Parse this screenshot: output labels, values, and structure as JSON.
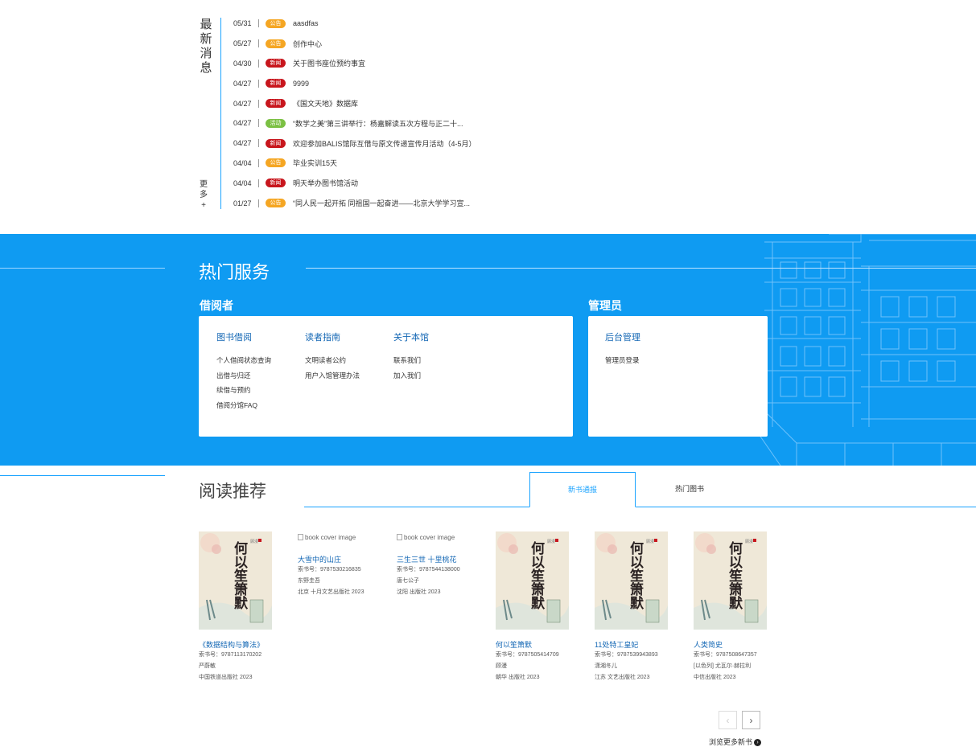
{
  "news": {
    "title": [
      "最",
      "新",
      "消",
      "息"
    ],
    "more": [
      "更",
      "多",
      "+"
    ],
    "items": [
      {
        "date": "05/31",
        "tag": "公告",
        "tag_color": "#f5a623",
        "text": "aasdfas"
      },
      {
        "date": "05/27",
        "tag": "公告",
        "tag_color": "#f5a623",
        "text": "创作中心"
      },
      {
        "date": "04/30",
        "tag": "新闻",
        "tag_color": "#c8161d",
        "text": "关于图书座位预约事宜"
      },
      {
        "date": "04/27",
        "tag": "新闻",
        "tag_color": "#c8161d",
        "text": "9999"
      },
      {
        "date": "04/27",
        "tag": "新闻",
        "tag_color": "#c8161d",
        "text": "《国文天地》数据库"
      },
      {
        "date": "04/27",
        "tag": "活动",
        "tag_color": "#7bc043",
        "text": "“数学之美”第三讲举行：杨嘉解读五次方程与正二十..."
      },
      {
        "date": "04/27",
        "tag": "新闻",
        "tag_color": "#c8161d",
        "text": "欢迎参加BALIS馆际互借与原文传递宣传月活动（4-5月）"
      },
      {
        "date": "04/04",
        "tag": "公告",
        "tag_color": "#f5a623",
        "text": "毕业实训15天"
      },
      {
        "date": "04/04",
        "tag": "新闻",
        "tag_color": "#c8161d",
        "text": "明天举办图书馆活动"
      },
      {
        "date": "01/27",
        "tag": "公告",
        "tag_color": "#f5a623",
        "text": "“同人民一起开拓 同祖国一起奋进——北京大学学习宣..."
      }
    ]
  },
  "services": {
    "title": "热门服务",
    "reader_label": "借阅者",
    "admin_label": "管理员",
    "columns": [
      {
        "head": "图书借阅",
        "links": [
          "个人借阅状态查询",
          "出借与归还",
          "续借与预约",
          "借阅分馆FAQ"
        ]
      },
      {
        "head": "读者指南",
        "links": [
          "文明读者公约",
          "用户入馆管理办法"
        ]
      },
      {
        "head": "关于本馆",
        "links": [
          "联系我们",
          "加入我们"
        ]
      }
    ],
    "admin_column": {
      "head": "后台管理",
      "links": [
        "管理员登录"
      ]
    }
  },
  "recommend": {
    "title": "阅读推荐",
    "tabs": [
      "新书通报",
      "热门图书"
    ],
    "broken_alt": "book cover image",
    "books": [
      {
        "title": "《数据结构与算法》",
        "isbn": "索书号：9787113170202",
        "author": "严蔚敏",
        "publisher": "中国铁道出版社 2023",
        "has_cover": true
      },
      {
        "title": "大雪中的山庄",
        "isbn": "索书号：9787530216835",
        "author": "东野圭吾",
        "publisher": "北京 十月文艺出版社 2023",
        "has_cover": false
      },
      {
        "title": "三生三世 十里桃花",
        "isbn": "索书号：9787544138000",
        "author": "唐七公子",
        "publisher": "沈阳 出版社 2023",
        "has_cover": false
      },
      {
        "title": "何以笙箫默",
        "isbn": "索书号：9787505414709",
        "author": "顾漫",
        "publisher": "朝华 出版社 2023",
        "has_cover": true
      },
      {
        "title": "11处特工皇妃",
        "isbn": "索书号：9787539943893",
        "author": "潇湘冬儿",
        "publisher": "江苏 文艺出版社 2023",
        "has_cover": true
      },
      {
        "title": "人类简史",
        "isbn": "索书号：9787508647357",
        "author": "[以色列] 尤瓦尔·赫拉利",
        "publisher": "中信出版社 2023",
        "has_cover": true
      }
    ],
    "cover_text": "何以笙箫默",
    "prev": "‹",
    "next": "›",
    "more": "浏览更多新书",
    "more_icon": "›"
  }
}
